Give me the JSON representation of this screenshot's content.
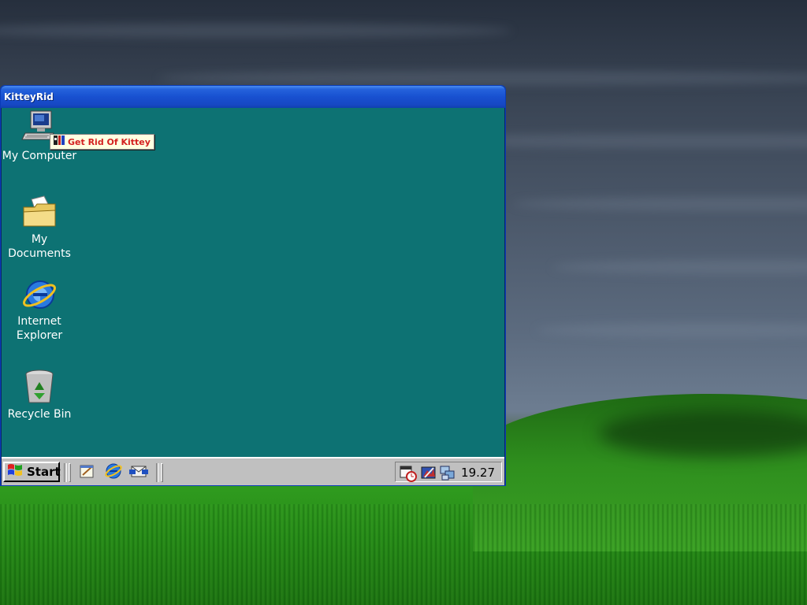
{
  "window": {
    "title": "KitteyRid"
  },
  "desktop_icons": [
    {
      "label": "My Computer",
      "icon": "my-computer-icon"
    },
    {
      "label": "My Documents",
      "icon": "my-documents-folder-icon"
    },
    {
      "label_line1": "Internet",
      "label_line2": "Explorer",
      "icon": "internet-explorer-icon"
    },
    {
      "label": "Recycle Bin",
      "icon": "recycle-bin-icon"
    }
  ],
  "tooltip": {
    "text": "Get Rid Of Kittey",
    "icon": "kitteyrid-app-icon"
  },
  "taskbar": {
    "start_label": "Start",
    "quick_launch": [
      {
        "icon": "show-desktop-icon"
      },
      {
        "icon": "internet-explorer-icon"
      },
      {
        "icon": "outlook-express-icon"
      }
    ],
    "tray_icons": [
      {
        "icon": "scheduler-icon"
      },
      {
        "icon": "display-settings-icon"
      },
      {
        "icon": "network-icon"
      }
    ],
    "clock": "19.27"
  },
  "colors": {
    "client_bg": "#0d7273",
    "title_bar": "#1850d0",
    "taskbar_bg": "#c0c0c0",
    "tooltip_bg": "#ffffe1",
    "tooltip_text": "#d42020"
  }
}
